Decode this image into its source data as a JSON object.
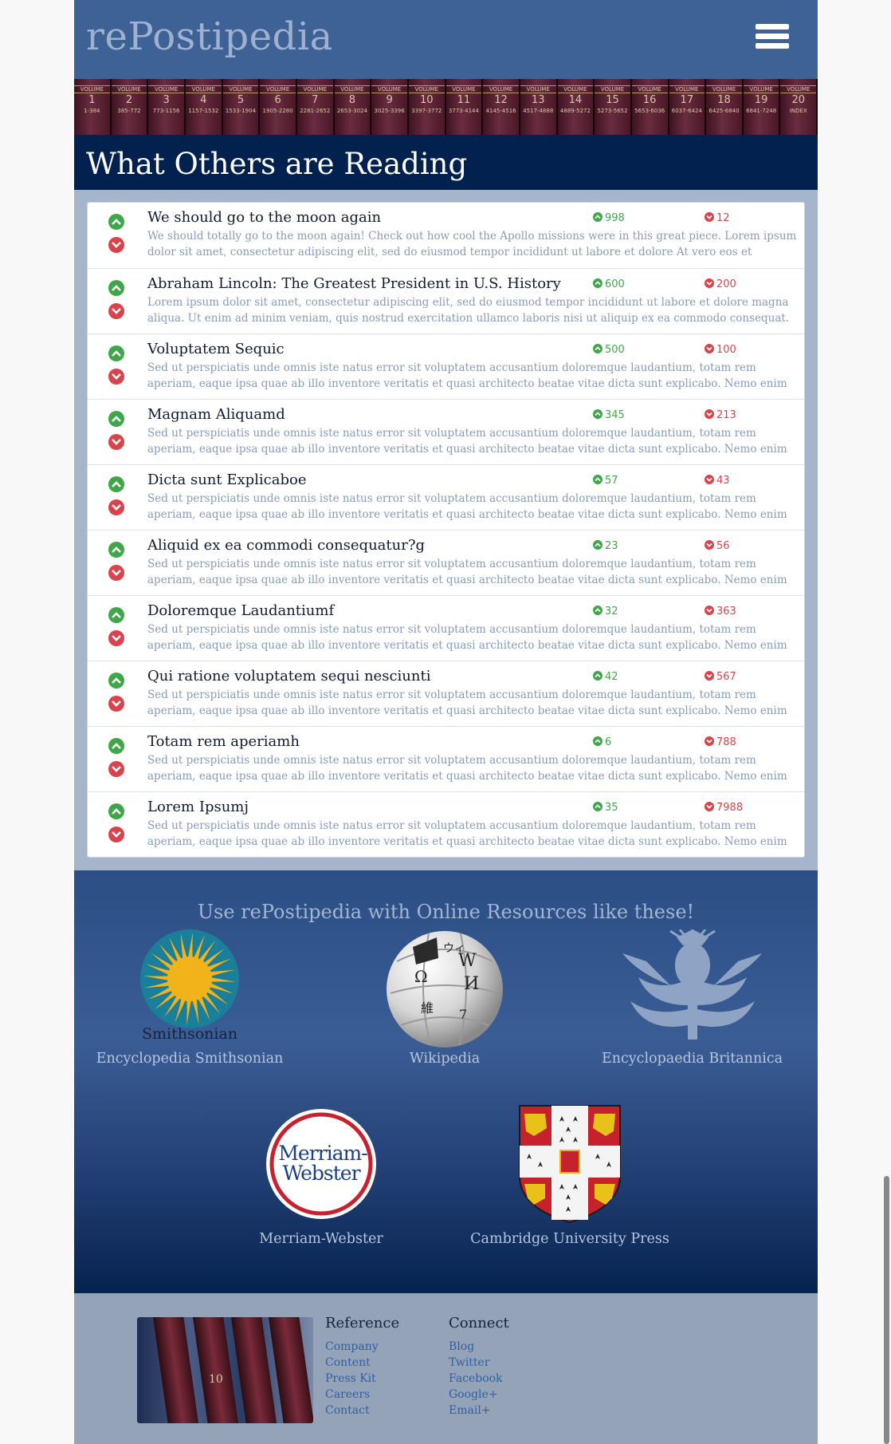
{
  "header": {
    "logo": "rePostipedia"
  },
  "books": [
    {
      "label": "VOLUME",
      "num": "1",
      "range": "1-384"
    },
    {
      "label": "VOLUME",
      "num": "2",
      "range": "385-772"
    },
    {
      "label": "VOLUME",
      "num": "3",
      "range": "773-1156"
    },
    {
      "label": "VOLUME",
      "num": "4",
      "range": "1157-1532"
    },
    {
      "label": "VOLUME",
      "num": "5",
      "range": "1533-1904"
    },
    {
      "label": "VOLUME",
      "num": "6",
      "range": "1905-2280"
    },
    {
      "label": "VOLUME",
      "num": "7",
      "range": "2281-2652"
    },
    {
      "label": "VOLUME",
      "num": "8",
      "range": "2653-3024"
    },
    {
      "label": "VOLUME",
      "num": "9",
      "range": "3025-3396"
    },
    {
      "label": "VOLUME",
      "num": "10",
      "range": "3397-3772"
    },
    {
      "label": "VOLUME",
      "num": "11",
      "range": "3773-4144"
    },
    {
      "label": "VOLUME",
      "num": "12",
      "range": "4145-4516"
    },
    {
      "label": "VOLUME",
      "num": "13",
      "range": "4517-4888"
    },
    {
      "label": "VOLUME",
      "num": "14",
      "range": "4889-5272"
    },
    {
      "label": "VOLUME",
      "num": "15",
      "range": "5273-5652"
    },
    {
      "label": "VOLUME",
      "num": "16",
      "range": "5653-6036"
    },
    {
      "label": "VOLUME",
      "num": "17",
      "range": "6037-6424"
    },
    {
      "label": "VOLUME",
      "num": "18",
      "range": "6425-6840"
    },
    {
      "label": "VOLUME",
      "num": "19",
      "range": "6841-7248"
    },
    {
      "label": "VOLUME",
      "num": "20",
      "range": "INDEX"
    }
  ],
  "section_title": "What Others are Reading",
  "posts": [
    {
      "title": "We should go to the moon again",
      "up": "998",
      "down": "12",
      "desc": "We should totally go to the moon again! Check out how cool the Apollo missions were in this great piece. Lorem ipsum dolor sit amet, consectetur adipiscing elit, sed do eiusmod tempor incididunt ut labore et dolore At vero eos et accusamus"
    },
    {
      "title": "Abraham Lincoln: The Greatest President in U.S. History",
      "up": "600",
      "down": "200",
      "desc": "Lorem ipsum dolor sit amet, consectetur adipiscing elit, sed do eiusmod tempor incididunt ut labore et dolore magna aliqua. Ut enim ad minim veniam, quis nostrud exercitation ullamco laboris nisi ut aliquip ex ea commodo consequat."
    },
    {
      "title": "Voluptatem Sequic",
      "up": "500",
      "down": "100",
      "desc": "Sed ut perspiciatis unde omnis iste natus error sit voluptatem accusantium doloremque laudantium, totam rem aperiam, eaque ipsa quae ab illo inventore veritatis et quasi architecto beatae vitae dicta sunt explicabo. Nemo enim ipsam"
    },
    {
      "title": "Magnam Aliquamd",
      "up": "345",
      "down": "213",
      "desc": "Sed ut perspiciatis unde omnis iste natus error sit voluptatem accusantium doloremque laudantium, totam rem aperiam, eaque ipsa quae ab illo inventore veritatis et quasi architecto beatae vitae dicta sunt explicabo. Nemo enim ipsam"
    },
    {
      "title": "Dicta sunt Explicaboe",
      "up": "57",
      "down": "43",
      "desc": "Sed ut perspiciatis unde omnis iste natus error sit voluptatem accusantium doloremque laudantium, totam rem aperiam, eaque ipsa quae ab illo inventore veritatis et quasi architecto beatae vitae dicta sunt explicabo. Nemo enim ipsam"
    },
    {
      "title": "Aliquid ex ea commodi consequatur?g",
      "up": "23",
      "down": "56",
      "desc": "Sed ut perspiciatis unde omnis iste natus error sit voluptatem accusantium doloremque laudantium, totam rem aperiam, eaque ipsa quae ab illo inventore veritatis et quasi architecto beatae vitae dicta sunt explicabo. Nemo enim ipsam"
    },
    {
      "title": "Doloremque Laudantiumf",
      "up": "32",
      "down": "363",
      "desc": "Sed ut perspiciatis unde omnis iste natus error sit voluptatem accusantium doloremque laudantium, totam rem aperiam, eaque ipsa quae ab illo inventore veritatis et quasi architecto beatae vitae dicta sunt explicabo. Nemo enim ipsam"
    },
    {
      "title": "Qui ratione voluptatem sequi nesciunti",
      "up": "42",
      "down": "567",
      "desc": "Sed ut perspiciatis unde omnis iste natus error sit voluptatem accusantium doloremque laudantium, totam rem aperiam, eaque ipsa quae ab illo inventore veritatis et quasi architecto beatae vitae dicta sunt explicabo. Nemo enim ipsam"
    },
    {
      "title": "Totam rem aperiamh",
      "up": "6",
      "down": "788",
      "desc": "Sed ut perspiciatis unde omnis iste natus error sit voluptatem accusantium doloremque laudantium, totam rem aperiam, eaque ipsa quae ab illo inventore veritatis et quasi architecto beatae vitae dicta sunt explicabo. Nemo enim ipsam"
    },
    {
      "title": "Lorem Ipsumj",
      "up": "35",
      "down": "7988",
      "desc": "Sed ut perspiciatis unde omnis iste natus error sit voluptatem accusantium doloremque laudantium, totam rem aperiam, eaque ipsa quae ab illo inventore veritatis et quasi architecto beatae vitae dicta sunt explicabo. Nemo enim ipsam"
    }
  ],
  "resources": {
    "heading": "Use rePostipedia with Online Resources like these!",
    "smithsonian": {
      "label": "Encyclopedia Smithsonian",
      "logo_text": "Smithsonian"
    },
    "wikipedia": {
      "label": "Wikipedia",
      "puzzle_glyphs": [
        "W",
        "Ω",
        "И",
        "維",
        "ウィ",
        "7"
      ]
    },
    "britannica": {
      "label": "Encyclopaedia Britannica"
    },
    "merriam": {
      "label": "Merriam-Webster",
      "logo_line1": "Merriam-",
      "logo_line2": "Webster"
    },
    "cambridge": {
      "label": "Cambridge University Press"
    }
  },
  "footer": {
    "columns": [
      {
        "heading": "Reference",
        "links": [
          "Company",
          "Content",
          "Press Kit",
          "Careers",
          "Contact"
        ]
      },
      {
        "heading": "Connect",
        "links": [
          "Blog",
          "Twitter",
          "Facebook",
          "Google+",
          "Email+"
        ]
      }
    ],
    "image_volume": "10"
  },
  "colors": {
    "up": "#3fa74a",
    "down": "#d9434b",
    "header": "#3f6296",
    "title_bar": "#02214f"
  },
  "icons": [
    "menu-icon",
    "upvote-icon",
    "downvote-icon"
  ]
}
